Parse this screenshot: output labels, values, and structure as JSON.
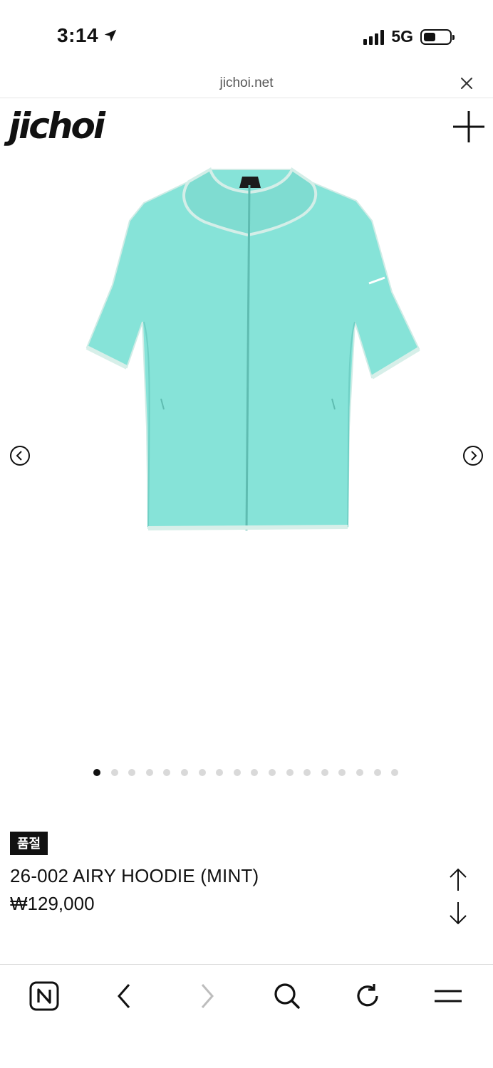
{
  "status_bar": {
    "time": "3:14",
    "network": "5G",
    "icons": [
      "location-arrow-icon",
      "signal-bars-icon",
      "battery-icon"
    ]
  },
  "browser": {
    "domain": "jichoi.net",
    "close_icon": "close-icon"
  },
  "site": {
    "logo": "jichoi",
    "menu_icon": "plus-icon"
  },
  "gallery": {
    "image": "mint short-sleeve zip hoodie",
    "prev_icon": "chevron-left-circle-icon",
    "next_icon": "chevron-right-circle-icon",
    "dot_count": 18,
    "active_dot": 0
  },
  "product": {
    "badge": "품절",
    "name": "26-002 AIRY HOODIE (MINT)",
    "price": "₩129,000",
    "scroll_icons": [
      "arrow-up-icon",
      "arrow-down-icon"
    ]
  },
  "toolbar": {
    "items": [
      "naver-n-icon",
      "back-icon",
      "forward-icon",
      "search-icon",
      "reload-icon",
      "menu-icon"
    ]
  },
  "colors": {
    "mint": "#86e3d8",
    "mint_trim": "#d7efe9",
    "text": "#111111",
    "forward_disabled": "#bdbdbd"
  }
}
